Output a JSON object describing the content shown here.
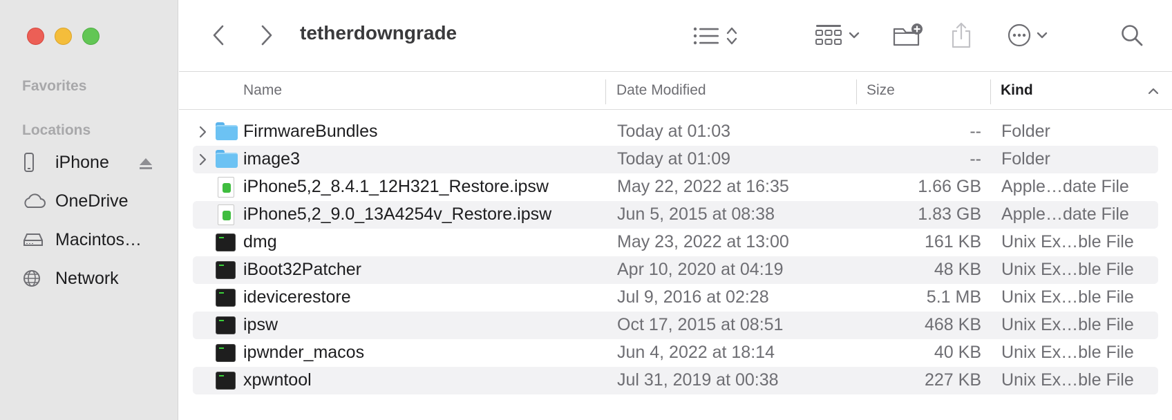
{
  "window": {
    "title": "tetherdowngrade"
  },
  "sidebar": {
    "favorites_label": "Favorites",
    "locations_label": "Locations",
    "items": [
      {
        "label": "iPhone",
        "icon": "iphone-icon",
        "eject": true
      },
      {
        "label": "OneDrive",
        "icon": "cloud-icon"
      },
      {
        "label": "Macintos…",
        "icon": "hard-drive-icon"
      },
      {
        "label": "Network",
        "icon": "globe-icon"
      }
    ]
  },
  "columns": {
    "name": "Name",
    "date_modified": "Date Modified",
    "size": "Size",
    "kind": "Kind"
  },
  "files": [
    {
      "name": "FirmwareBundles",
      "date": "Today at 01:03",
      "size": "--",
      "kind": "Folder",
      "icon": "folder-icon",
      "expandable": true
    },
    {
      "name": "image3",
      "date": "Today at 01:09",
      "size": "--",
      "kind": "Folder",
      "icon": "folder-icon",
      "expandable": true
    },
    {
      "name": "iPhone5,2_8.4.1_12H321_Restore.ipsw",
      "date": "May 22, 2022 at 16:35",
      "size": "1.66 GB",
      "kind": "Apple…date File",
      "icon": "ipsw-file-icon"
    },
    {
      "name": "iPhone5,2_9.0_13A4254v_Restore.ipsw",
      "date": "Jun 5, 2015 at 08:38",
      "size": "1.83 GB",
      "kind": "Apple…date File",
      "icon": "ipsw-file-icon"
    },
    {
      "name": "dmg",
      "date": "May 23, 2022 at 13:00",
      "size": "161 KB",
      "kind": "Unix Ex…ble File",
      "icon": "terminal-exec-icon"
    },
    {
      "name": "iBoot32Patcher",
      "date": "Apr 10, 2020 at 04:19",
      "size": "48 KB",
      "kind": "Unix Ex…ble File",
      "icon": "terminal-exec-icon"
    },
    {
      "name": "idevicerestore",
      "date": "Jul 9, 2016 at 02:28",
      "size": "5.1 MB",
      "kind": "Unix Ex…ble File",
      "icon": "terminal-exec-icon"
    },
    {
      "name": "ipsw",
      "date": "Oct 17, 2015 at 08:51",
      "size": "468 KB",
      "kind": "Unix Ex…ble File",
      "icon": "terminal-exec-icon"
    },
    {
      "name": "ipwnder_macos",
      "date": "Jun 4, 2022 at 18:14",
      "size": "40 KB",
      "kind": "Unix Ex…ble File",
      "icon": "terminal-exec-icon"
    },
    {
      "name": "xpwntool",
      "date": "Jul 31, 2019 at 00:38",
      "size": "227 KB",
      "kind": "Unix Ex…ble File",
      "icon": "terminal-exec-icon"
    }
  ]
}
